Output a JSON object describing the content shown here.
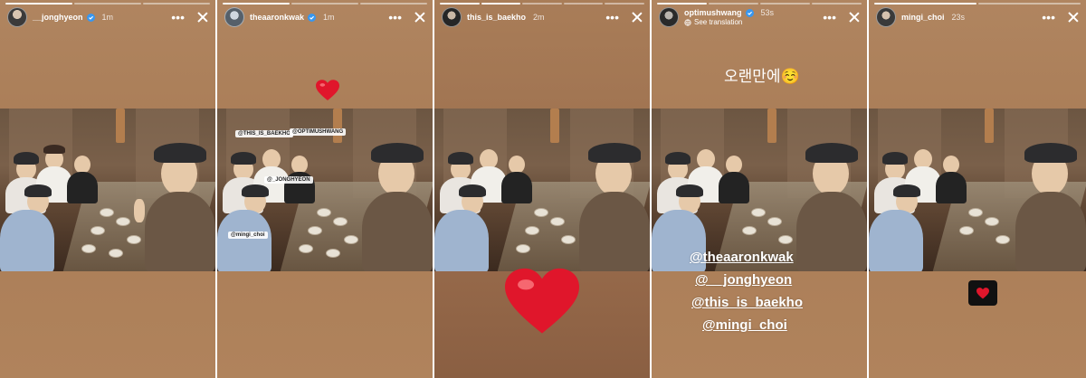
{
  "stories": [
    {
      "username": "__jonghyeon",
      "verified": true,
      "time": "1m",
      "progress_total": 3,
      "progress_done": 1,
      "caption": "",
      "stickers": [],
      "mentions": []
    },
    {
      "username": "theaaronkwak",
      "verified": true,
      "time": "1m",
      "progress_total": 3,
      "progress_done": 1,
      "stickers": [
        "@THIS_IS_BAEKHO",
        "@OPTIMUSHWANG",
        "@_JONGHYEON",
        "@mingi_choi"
      ],
      "emoji": "❤️"
    },
    {
      "username": "this_is_baekho",
      "verified": false,
      "time": "2m",
      "progress_total": 5,
      "progress_done": 2,
      "emoji": "❤️"
    },
    {
      "username": "optimushwang",
      "verified": true,
      "time": "53s",
      "translate_label": "See translation",
      "progress_total": 4,
      "progress_done": 1,
      "caption": "오랜만에☺️",
      "mentions": [
        "@theaaronkwak",
        "@__jonghyeon",
        "@this_is_baekho",
        "@mingi_choi"
      ]
    },
    {
      "username": "mingi_choi",
      "verified": false,
      "time": "23s",
      "progress_total": 2,
      "progress_done": 1,
      "emoji": "❤️"
    }
  ],
  "icons": {
    "more": "more-horizontal-icon",
    "close": "close-icon",
    "verified": "verified-badge-icon",
    "translate": "translate-icon"
  },
  "colors": {
    "verified_blue": "#3897f0",
    "heart_red": "#e0162b"
  }
}
